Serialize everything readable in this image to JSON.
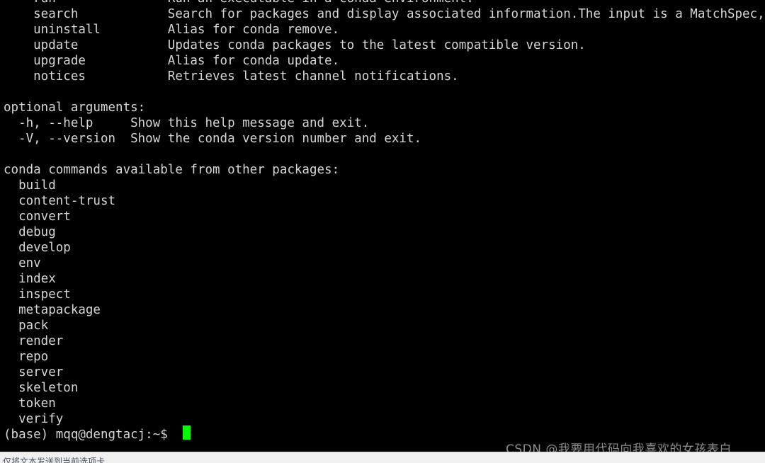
{
  "terminal": {
    "background_color": "#000000",
    "text_color": "#d6d6d6",
    "cursor_color": "#00ff00",
    "lines": [
      "    run               Run an executable in a conda environment.",
      "    search            Search for packages and display associated information.The input is a MatchSpec,",
      "    uninstall         Alias for conda remove.",
      "    update            Updates conda packages to the latest compatible version.",
      "    upgrade           Alias for conda update.",
      "    notices           Retrieves latest channel notifications.",
      "",
      "optional arguments:",
      "  -h, --help     Show this help message and exit.",
      "  -V, --version  Show the conda version number and exit.",
      "",
      "conda commands available from other packages:",
      "  build",
      "  content-trust",
      "  convert",
      "  debug",
      "  develop",
      "  env",
      "  index",
      "  inspect",
      "  metapackage",
      "  pack",
      "  render",
      "  repo",
      "  server",
      "  skeleton",
      "  token",
      "  verify"
    ],
    "prompt": "(base) mqq@dengtacj:~$ "
  },
  "watermark": {
    "text": "CSDN @我要用代码向我喜欢的女孩表白",
    "color": "#8d8d8d"
  },
  "statusbar": {
    "text": "仅将文本发送到当前选项卡",
    "background_color": "#f0f0f0",
    "text_color": "#4a5568"
  }
}
